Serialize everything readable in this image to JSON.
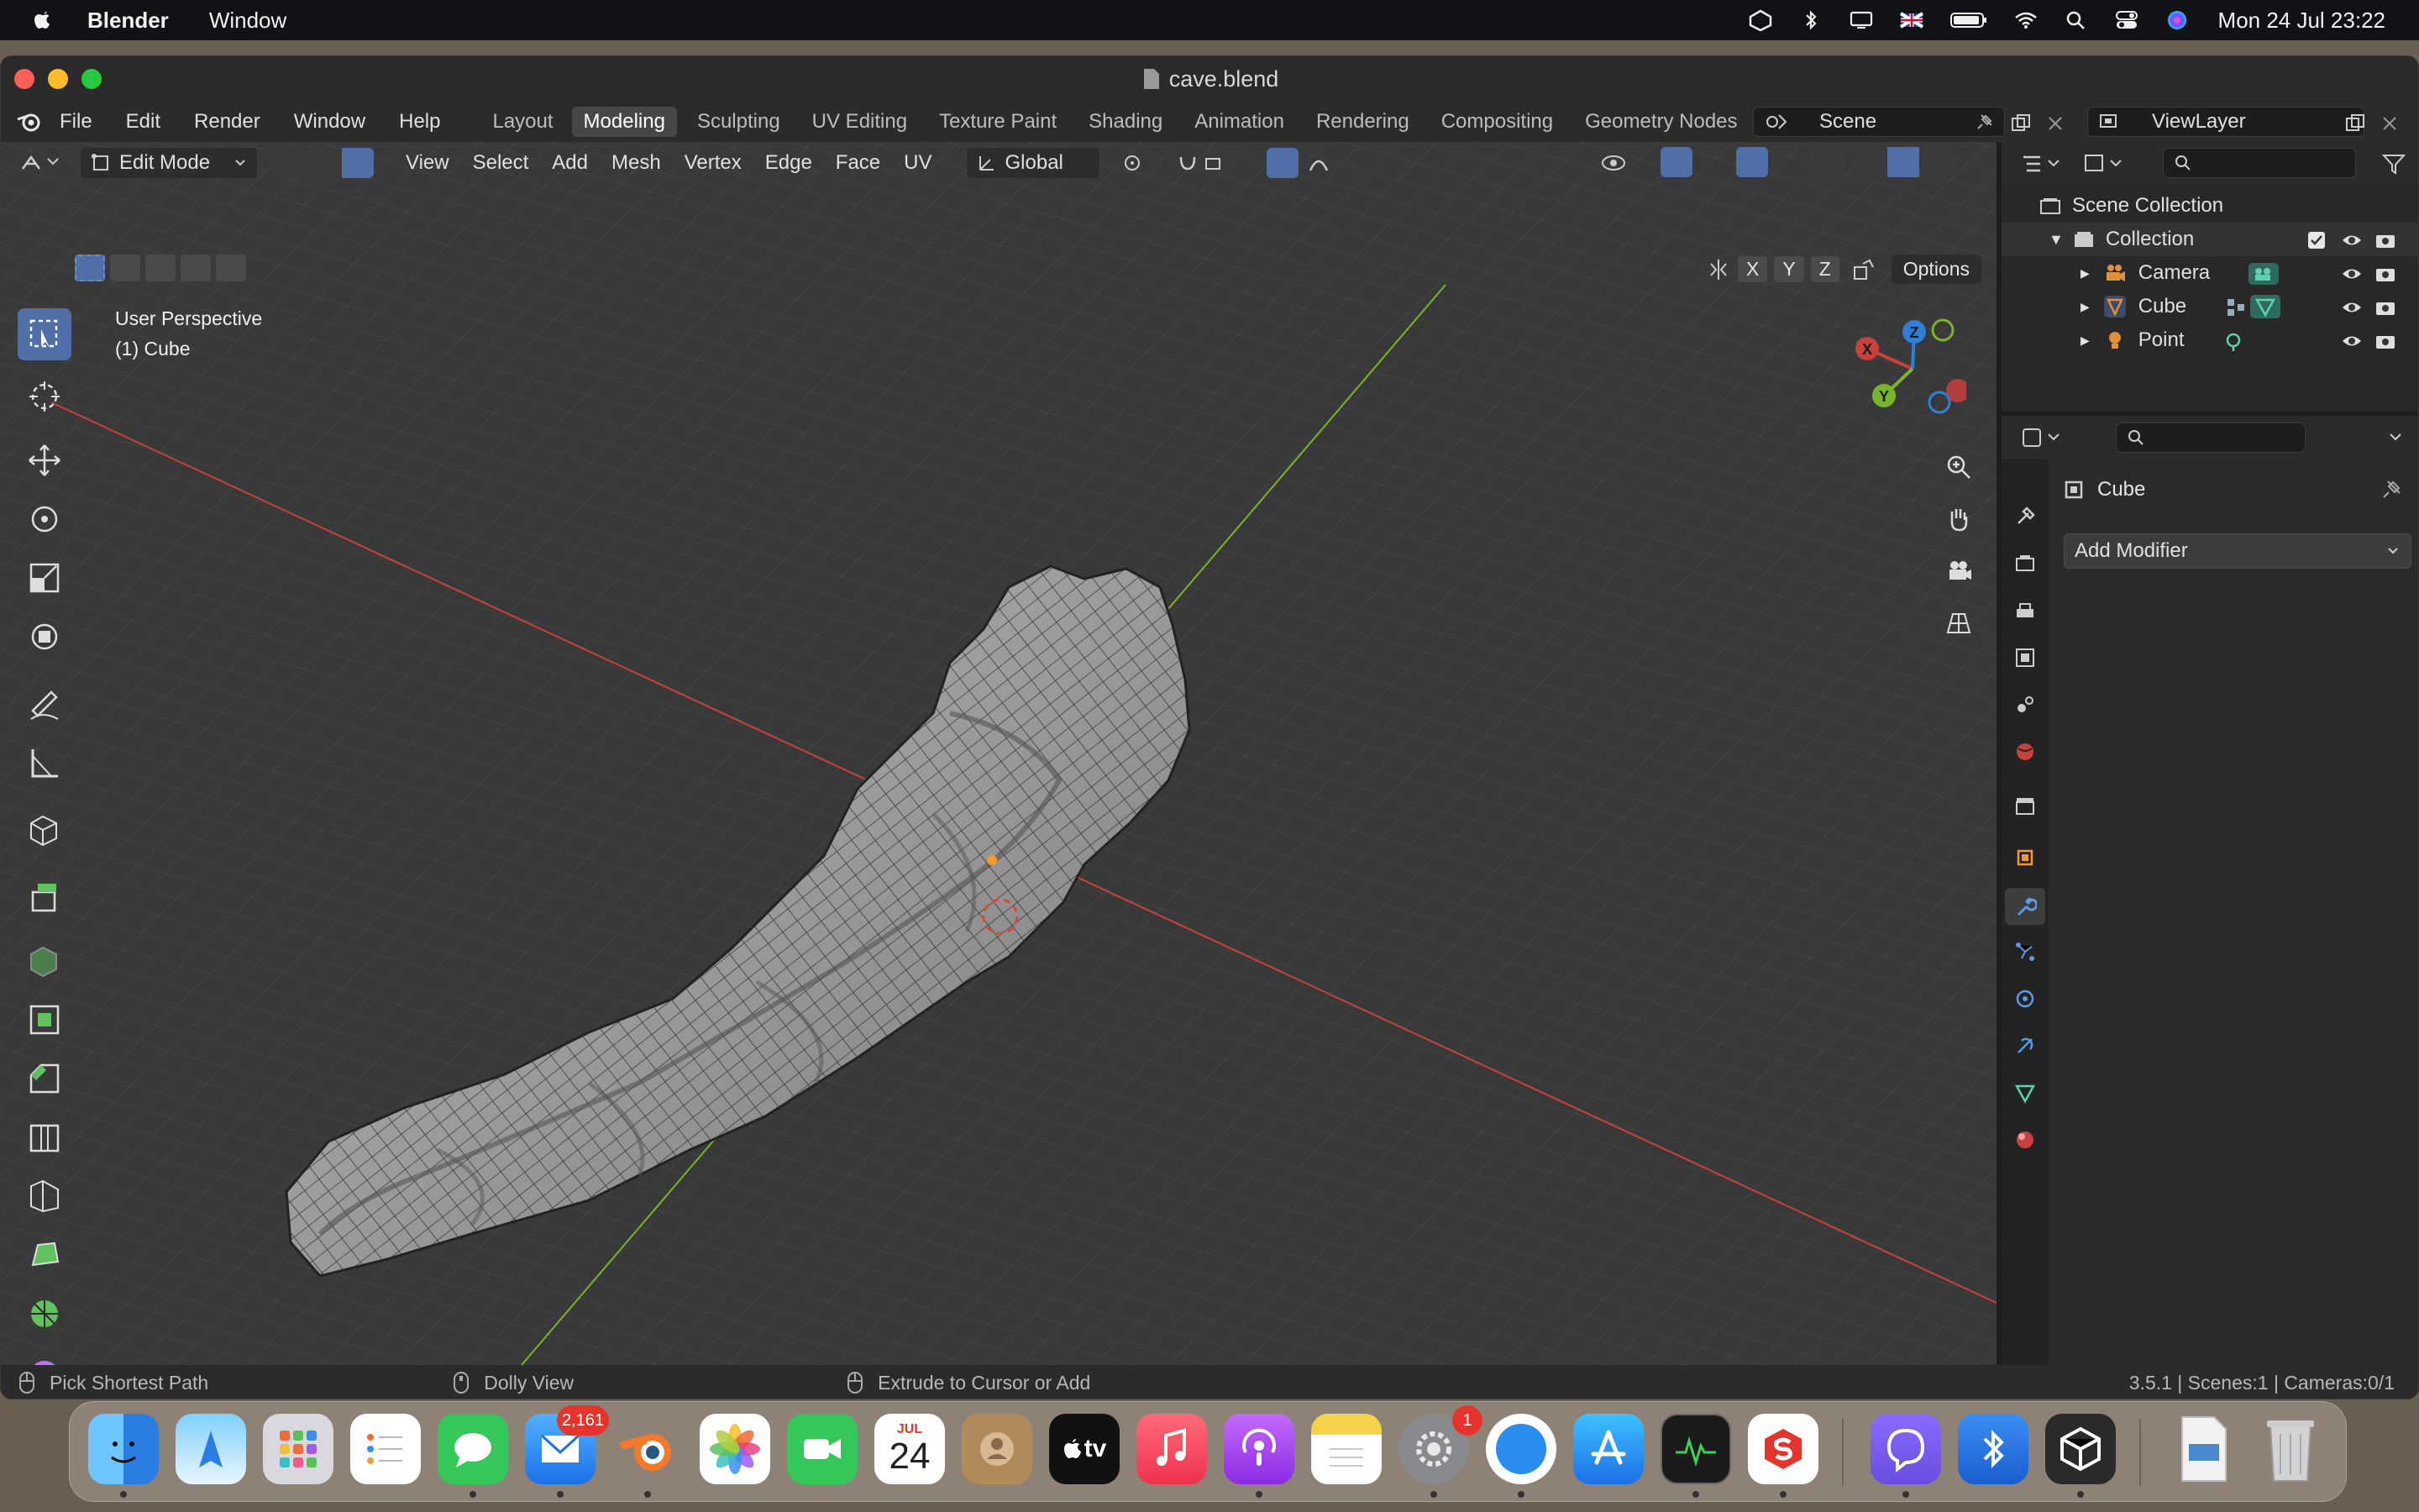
{
  "menubar": {
    "app_name": "Blender",
    "menus": [
      "Window"
    ],
    "date_time": "Mon 24 Jul  23:22"
  },
  "window": {
    "title": "cave.blend"
  },
  "topbar": {
    "menus": [
      "File",
      "Edit",
      "Render",
      "Window",
      "Help"
    ],
    "workspaces": [
      "Layout",
      "Modeling",
      "Sculpting",
      "UV Editing",
      "Texture Paint",
      "Shading",
      "Animation",
      "Rendering",
      "Compositing",
      "Geometry Nodes"
    ],
    "active_workspace": "Modeling",
    "scene": "Scene",
    "view_layer": "ViewLayer"
  },
  "viewport_header": {
    "mode": "Edit Mode",
    "menus": [
      "View",
      "Select",
      "Add",
      "Mesh",
      "Vertex",
      "Edge",
      "Face",
      "UV"
    ],
    "orientation": "Global",
    "axes": [
      "X",
      "Y",
      "Z"
    ],
    "options": "Options"
  },
  "viewport": {
    "perspective": "User Perspective",
    "object": "(1) Cube"
  },
  "gizmo": {
    "x": "X",
    "y": "Y",
    "z": "Z"
  },
  "outliner": {
    "root": "Scene Collection",
    "collection": "Collection",
    "items": [
      "Camera",
      "Cube",
      "Point"
    ]
  },
  "properties": {
    "object_name": "Cube",
    "add_modifier": "Add Modifier"
  },
  "statusbar": {
    "left": "Pick Shortest Path",
    "middle": "Dolly View",
    "right_action": "Extrude to Cursor or Add",
    "info": "3.5.1 | Scenes:1 | Cameras:0/1"
  },
  "dock": {
    "mail_badge": "2,161",
    "calendar_month": "JUL",
    "calendar_day": "24",
    "settings_badge": "1",
    "tv_label": "tv"
  },
  "colors": {
    "x_axis": "#c8413e",
    "y_axis": "#7ab42a",
    "z_axis": "#2f7fd8",
    "accent_active": "#4f6fa6"
  }
}
